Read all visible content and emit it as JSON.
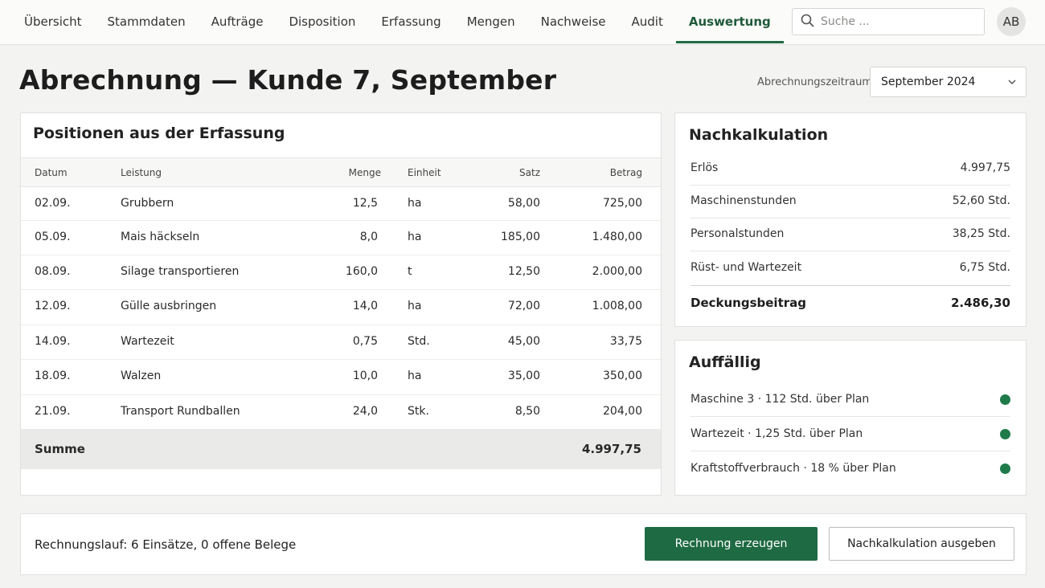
{
  "nav": {
    "items": [
      {
        "label": "Übersicht",
        "active": false
      },
      {
        "label": "Stammdaten",
        "active": false
      },
      {
        "label": "Aufträge",
        "active": false
      },
      {
        "label": "Disposition",
        "active": false
      },
      {
        "label": "Erfassung",
        "active": false
      },
      {
        "label": "Mengen",
        "active": false
      },
      {
        "label": "Nachweise",
        "active": false
      },
      {
        "label": "Audit",
        "active": false
      },
      {
        "label": "Auswertung",
        "active": true
      }
    ],
    "search_placeholder": "Suche ...",
    "avatar_initials": "AB"
  },
  "header": {
    "title": "Abrechnung — Kunde 7, September",
    "period_label": "Abrechnungszeitraum",
    "period_value": "September 2024"
  },
  "positions": {
    "title": "Positionen aus der Erfassung",
    "columns": {
      "date": "Datum",
      "service": "Leistung",
      "qty": "Menge",
      "unit": "Einheit",
      "rate": "Satz",
      "amount": "Betrag"
    },
    "rows": [
      {
        "date": "02.09.",
        "service": "Grubbern",
        "qty": "12,5",
        "unit": "ha",
        "rate": "58,00",
        "amount": "725,00"
      },
      {
        "date": "05.09.",
        "service": "Mais häckseln",
        "qty": "8,0",
        "unit": "ha",
        "rate": "185,00",
        "amount": "1.480,00"
      },
      {
        "date": "08.09.",
        "service": "Silage transportieren",
        "qty": "160,0",
        "unit": "t",
        "rate": "12,50",
        "amount": "2.000,00"
      },
      {
        "date": "12.09.",
        "service": "Gülle ausbringen",
        "qty": "14,0",
        "unit": "ha",
        "rate": "72,00",
        "amount": "1.008,00"
      },
      {
        "date": "14.09.",
        "service": "Wartezeit",
        "qty": "0,75",
        "unit": "Std.",
        "rate": "45,00",
        "amount": "33,75"
      },
      {
        "date": "18.09.",
        "service": "Walzen",
        "qty": "10,0",
        "unit": "ha",
        "rate": "35,00",
        "amount": "350,00"
      },
      {
        "date": "21.09.",
        "service": "Transport Rundballen",
        "qty": "24,0",
        "unit": "Stk.",
        "rate": "8,50",
        "amount": "204,00"
      }
    ],
    "sum_label": "Summe",
    "sum_value": "4.997,75"
  },
  "calc": {
    "title": "Nachkalkulation",
    "rows": [
      {
        "label": "Erlös",
        "value": "4.997,75"
      },
      {
        "label": "Maschinenstunden",
        "value": "52,60  Std."
      },
      {
        "label": "Personalstunden",
        "value": "38,25  Std."
      },
      {
        "label": "Rüst- und Wartezeit",
        "value": "6,75  Std."
      }
    ],
    "total_label": "Deckungsbeitrag",
    "total_value": "2.486,30"
  },
  "flags": {
    "title": "Auffällig",
    "items": [
      {
        "label": "Maschine 3  ·  112 Std. über Plan",
        "color": "#1f7a4a"
      },
      {
        "label": "Wartezeit  ·  1,25 Std. über Plan",
        "color": "#1f7a4a"
      },
      {
        "label": "Kraftstoffverbrauch  ·  18 % über Plan",
        "color": "#1f7a4a"
      }
    ]
  },
  "footer": {
    "run_text": "Rechnungslauf:  6 Einsätze, 0 offene Belege",
    "primary_button": "Rechnung erzeugen",
    "secondary_button": "Nachkalkulation ausgeben"
  },
  "colors": {
    "accent": "#1e6a43",
    "status_dot": "#1f7a4a"
  }
}
